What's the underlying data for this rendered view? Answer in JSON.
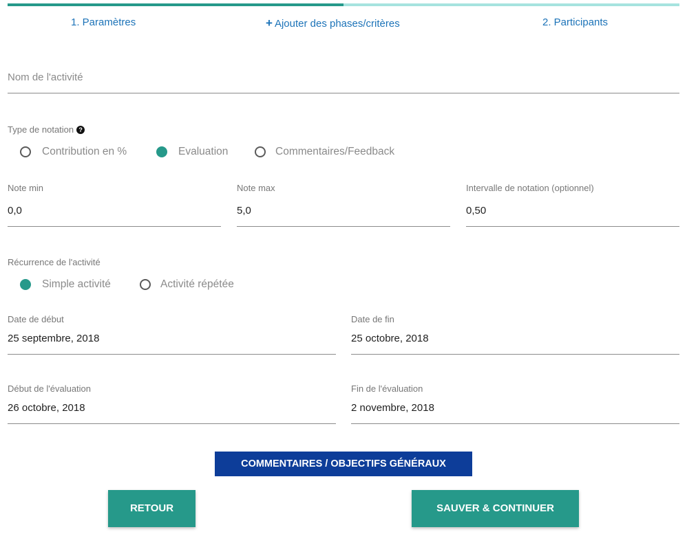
{
  "steps": {
    "step1": "1. Paramètres",
    "add_phases": "Ajouter des phases/critères",
    "step2": "2. Participants"
  },
  "activity_name": {
    "placeholder": "Nom de l'activité"
  },
  "notation": {
    "label": "Type de notation",
    "help_icon": "?",
    "options": [
      "Contribution en %",
      "Evaluation",
      "Commentaires/Feedback"
    ],
    "selected": "Evaluation"
  },
  "grades": {
    "min_label": "Note min",
    "min_value": "0,0",
    "max_label": "Note max",
    "max_value": "5,0",
    "interval_label": "Intervalle de notation (optionnel)",
    "interval_value": "0,50"
  },
  "recurrence": {
    "label": "Récurrence de l'activité",
    "options": [
      "Simple activité",
      "Activité répétée"
    ],
    "selected": "Simple activité"
  },
  "dates": {
    "start_label": "Date de début",
    "start_value": "25 septembre, 2018",
    "end_label": "Date de fin",
    "end_value": "25 octobre, 2018",
    "eval_start_label": "Début de l'évaluation",
    "eval_start_value": "26 octobre, 2018",
    "eval_end_label": "Fin de l'évaluation",
    "eval_end_value": "2 novembre, 2018"
  },
  "buttons": {
    "comments": "COMMENTAIRES / OBJECTIFS GÉNÉRAUX",
    "back": "RETOUR",
    "save": "SAUVER & CONTINUER"
  },
  "progress": {
    "fraction": 0.5
  },
  "colors": {
    "teal": "#26998a",
    "teal_light": "#a6e3df",
    "link_blue": "#1c73b8",
    "navy": "#0d3d99"
  }
}
